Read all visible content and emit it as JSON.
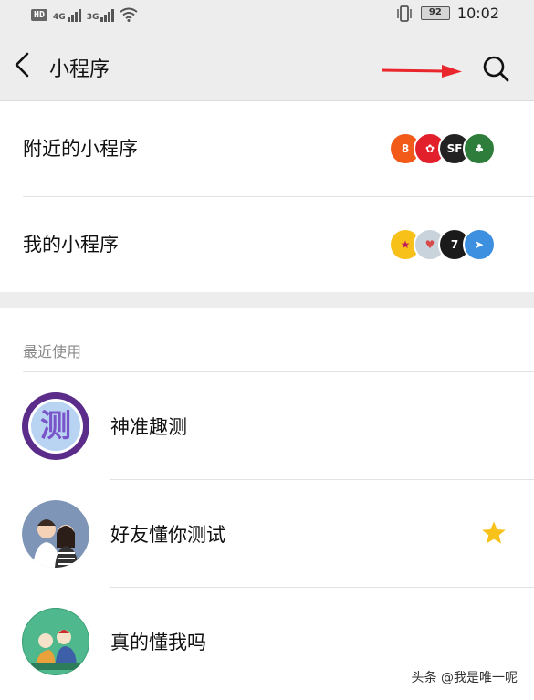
{
  "status_bar": {
    "hd": "HD",
    "net1": "4G",
    "net2": "3G",
    "battery": "92",
    "time": "10:02"
  },
  "header": {
    "title": "小程序",
    "back_icon": "back-chevron-icon",
    "search_icon": "search-icon"
  },
  "nearby": {
    "label": "附近的小程序",
    "thumbs": [
      {
        "name": "orange-app-icon",
        "color": "#f25a1a",
        "glyph": "8"
      },
      {
        "name": "red-app-icon",
        "color": "#e2202c",
        "glyph": "✿"
      },
      {
        "name": "sf-app-icon",
        "color": "#222222",
        "glyph": "SF"
      },
      {
        "name": "green-app-icon",
        "color": "#2e7d3a",
        "glyph": "♣"
      }
    ]
  },
  "mine": {
    "label": "我的小程序",
    "thumbs": [
      {
        "name": "yellow-app-icon",
        "color": "#f7c11a",
        "glyph": "★"
      },
      {
        "name": "couple-app-icon",
        "color": "#c9d3dc",
        "glyph": "♥"
      },
      {
        "name": "black-app-icon",
        "color": "#1a1a1a",
        "glyph": "7"
      },
      {
        "name": "blue-app-icon",
        "color": "#3d8fe0",
        "glyph": "➤"
      }
    ]
  },
  "recent": {
    "label": "最近使用",
    "items": [
      {
        "name": "神准趣测",
        "avatar_text": "测",
        "starred": false
      },
      {
        "name": "好友懂你测试",
        "starred": true
      },
      {
        "name": "真的懂我吗",
        "starred": false
      }
    ]
  },
  "watermark": "头条 @我是唯一呢",
  "colors": {
    "background": "#ededed",
    "card": "#ffffff",
    "arrow": "#e8262b",
    "star": "#f6c21b"
  }
}
